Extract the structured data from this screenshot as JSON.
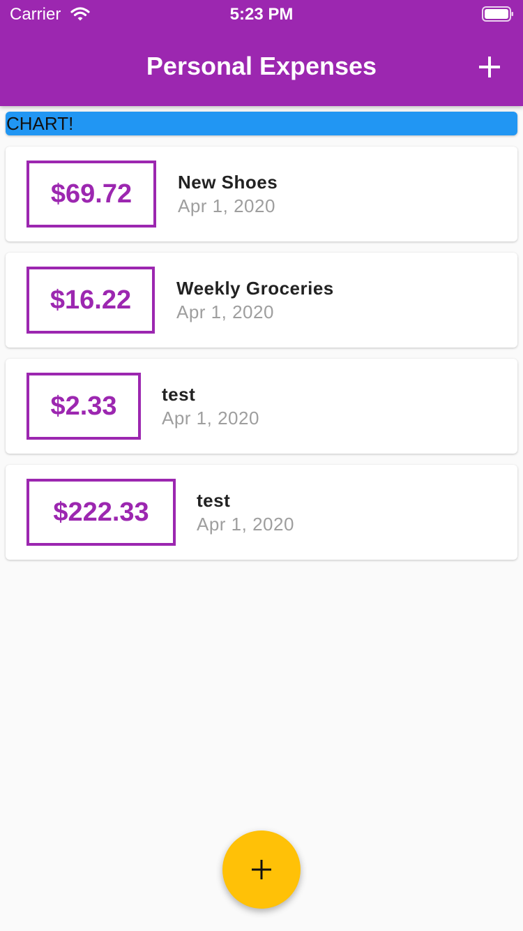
{
  "status_bar": {
    "carrier": "Carrier",
    "time": "5:23 PM"
  },
  "app_bar": {
    "title": "Personal Expenses",
    "add_icon": "plus-icon"
  },
  "chart_placeholder": "CHART!",
  "transactions": [
    {
      "amount": "$69.72",
      "title": "New Shoes",
      "date": "Apr 1, 2020"
    },
    {
      "amount": "$16.22",
      "title": "Weekly Groceries",
      "date": "Apr 1, 2020"
    },
    {
      "amount": "$2.33",
      "title": "test",
      "date": "Apr 1, 2020"
    },
    {
      "amount": "$222.33",
      "title": "test",
      "date": "Apr 1, 2020"
    }
  ],
  "fab": {
    "icon": "plus-icon"
  },
  "colors": {
    "primary": "#9c27b0",
    "chart": "#2196f3",
    "accent": "#ffc107",
    "background": "#fafafa"
  }
}
